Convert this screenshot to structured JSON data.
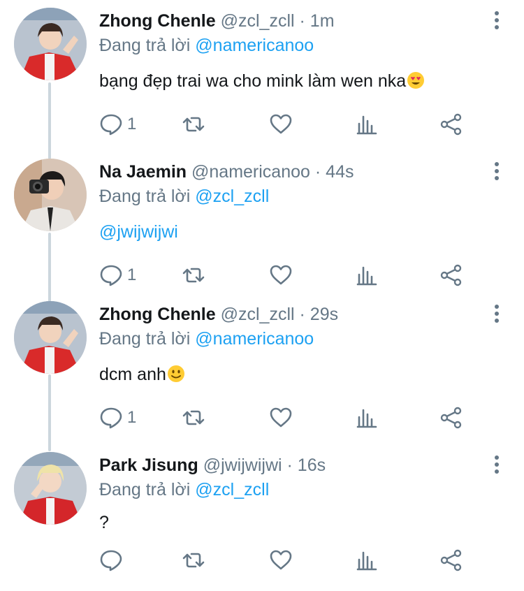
{
  "reply_prefix": "Đang trả lời",
  "tweets": [
    {
      "author_name": "Zhong Chenle",
      "handle": "@zcl_zcll",
      "separator": "·",
      "time": "1m",
      "reply_to": "@namericanoo",
      "text": "bạng đẹp trai wa cho mink làm wen nka",
      "emoji": "heart-eyes-emoji",
      "reply_count": "1",
      "avatar_icon": "avatar-red-jacket"
    },
    {
      "author_name": "Na Jaemin",
      "handle": "@namericanoo",
      "separator": "·",
      "time": "44s",
      "reply_to": "@zcl_zcll",
      "text": "@jwijwijwi",
      "emoji": "",
      "reply_count": "1",
      "avatar_icon": "avatar-camera"
    },
    {
      "author_name": "Zhong Chenle",
      "handle": "@zcl_zcll",
      "separator": "·",
      "time": "29s",
      "reply_to": "@namericanoo",
      "text": "dcm anh",
      "emoji": "slightly-smiling-emoji",
      "reply_count": "1",
      "avatar_icon": "avatar-red-jacket"
    },
    {
      "author_name": "Park Jisung",
      "handle": "@jwijwijwi",
      "separator": "·",
      "time": "16s",
      "reply_to": "@zcl_zcll",
      "text": "?",
      "emoji": "",
      "reply_count": "",
      "avatar_icon": "avatar-blond"
    }
  ],
  "colors": {
    "text": "#14171a",
    "secondary": "#657786",
    "link": "#1da1f2",
    "thread_line": "#ccd6dd"
  }
}
